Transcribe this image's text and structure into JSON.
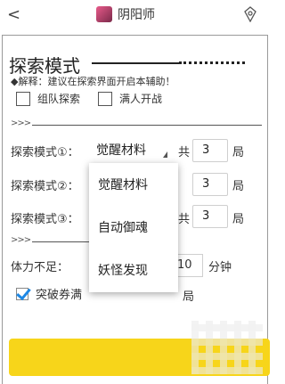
{
  "header": {
    "back_glyph": "<",
    "title": "阴阳师",
    "icons": [
      "back-icon",
      "app-avatar",
      "rune-icon"
    ]
  },
  "section": {
    "title": "探索模式",
    "note": "◆解释：建议在探索界面开启本辅助！"
  },
  "options": {
    "team_explore": "组队探索",
    "full_start": "满人开战"
  },
  "separator": ">>>",
  "modes": [
    {
      "label": "探索模式①：",
      "value": "觉醒材料",
      "count_prefix": "共",
      "count": "3",
      "count_suffix": "局"
    },
    {
      "label": "探索模式②：",
      "value": "",
      "count_prefix": "共",
      "count": "3",
      "count_suffix": "局"
    },
    {
      "label": "探索模式③：",
      "value": "",
      "count_prefix": "共",
      "count": "3",
      "count_suffix": "局"
    }
  ],
  "dropdown": {
    "options": [
      "觉醒材料",
      "自动御魂",
      "妖怪发现"
    ]
  },
  "stamina": {
    "label": "体力不足：",
    "value": "10",
    "unit": "分钟"
  },
  "ticket": {
    "label": "突破券满",
    "count_suffix": "局"
  },
  "colors": {
    "accent_yellow": "#f7d51a",
    "checkbox_blue": "#1e88e5"
  }
}
